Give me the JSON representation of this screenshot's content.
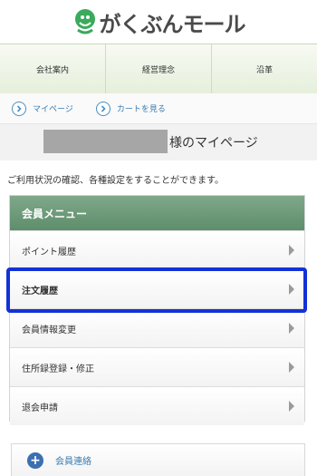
{
  "logo": {
    "text": "がくぶんモール"
  },
  "top_nav": {
    "items": [
      {
        "label": "会社案内"
      },
      {
        "label": "経営理念"
      },
      {
        "label": "沿革"
      }
    ]
  },
  "breadcrumbs": [
    {
      "label": "マイページ"
    },
    {
      "label": "カートを見る"
    }
  ],
  "welcome": {
    "suffix": "様のマイページ"
  },
  "intro_text": "ご利用状況の確認、各種設定をすることができます。",
  "member_menu": {
    "title": "会員メニュー",
    "items": [
      {
        "label": "ポイント履歴"
      },
      {
        "label": "注文履歴"
      },
      {
        "label": "会員情報変更"
      },
      {
        "label": "住所録登録・修正"
      },
      {
        "label": "退会申請"
      }
    ]
  },
  "contact": {
    "label": "会員連絡"
  },
  "colors": {
    "accent_green": "#6a9a76",
    "link_blue": "#3a7cb0",
    "highlight_border": "#1232d8"
  }
}
